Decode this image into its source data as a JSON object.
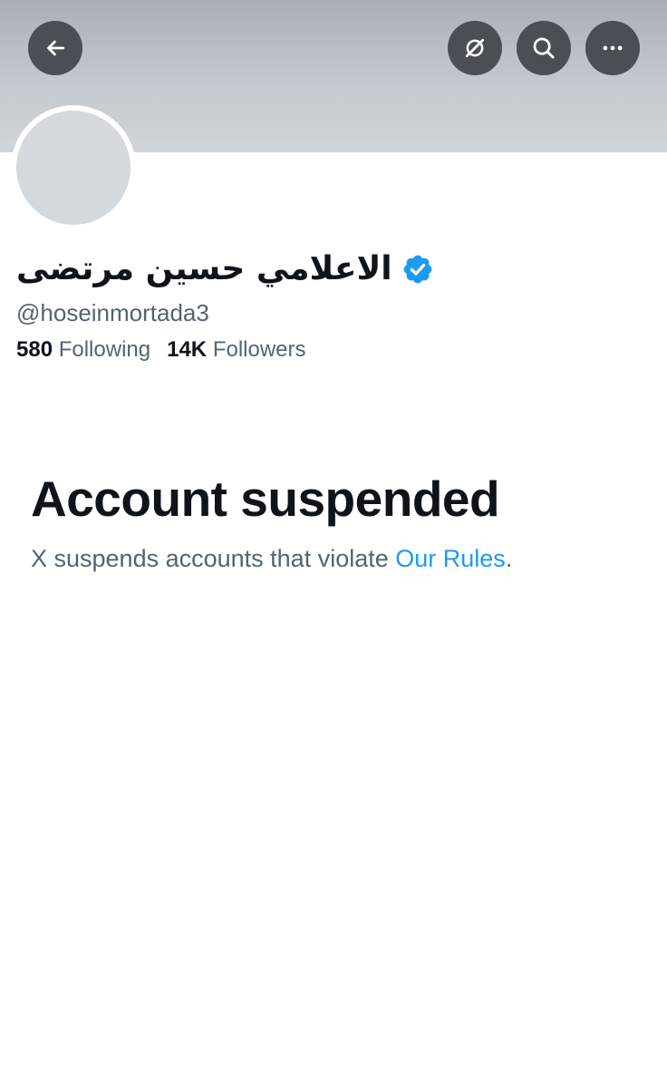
{
  "header": {
    "back_icon": "arrow-left-icon",
    "grok_icon": "grok-icon",
    "search_icon": "search-icon",
    "more_icon": "more-horizontal-icon"
  },
  "profile": {
    "display_name": "الاعلامي حسين مرتضى",
    "verified_icon": "verified-badge-icon",
    "verified_color": "#1d9bf0",
    "handle": "@hoseinmortada3",
    "following_count": "580",
    "following_label": "Following",
    "followers_count": "14K",
    "followers_label": "Followers"
  },
  "suspension": {
    "title": "Account suspended",
    "description_prefix": "X suspends accounts that violate",
    "rules_link": "Our Rules",
    "description_suffix": "."
  },
  "colors": {
    "link": "#1d9bf0",
    "secondary_text": "#536471",
    "primary_text": "#0f1419"
  }
}
